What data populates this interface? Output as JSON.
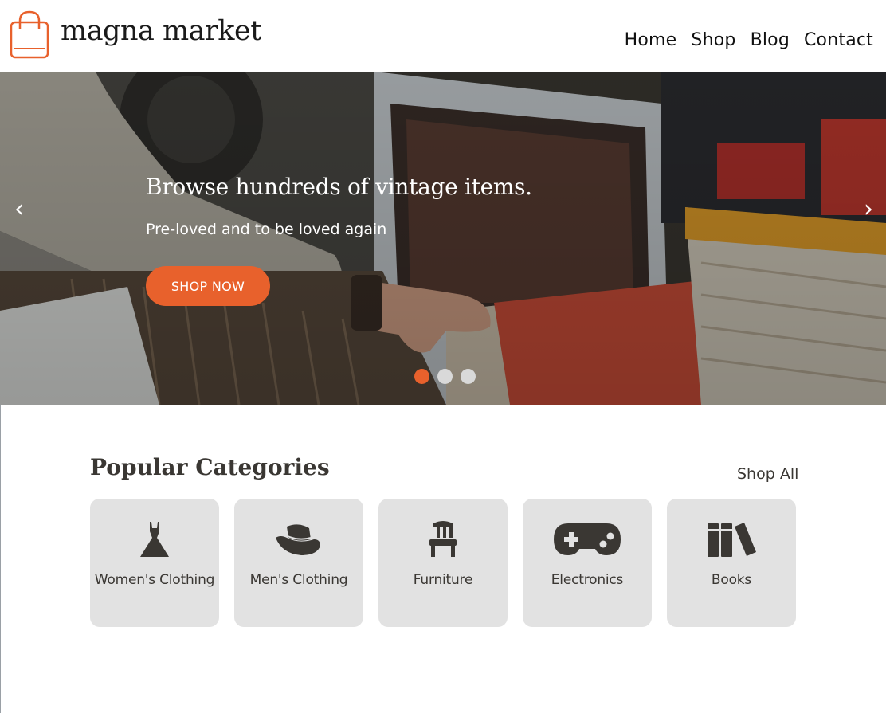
{
  "brand": {
    "name": "magna market",
    "accent": "#e8612c"
  },
  "nav": {
    "items": [
      {
        "label": "Home",
        "name": "nav-home"
      },
      {
        "label": "Shop",
        "name": "nav-shop"
      },
      {
        "label": "Blog",
        "name": "nav-blog"
      },
      {
        "label": "Contact",
        "name": "nav-contact"
      }
    ]
  },
  "hero": {
    "title": "Browse hundreds of vintage items.",
    "subtitle": "Pre-loved and to be loved again",
    "cta": "SHOP NOW",
    "prev_glyph": "‹",
    "next_glyph": "›",
    "slides_count": 3,
    "active_slide": 1
  },
  "categories": {
    "title": "Popular Categories",
    "shop_all": "Shop All",
    "items": [
      {
        "label": "Women's Clothing",
        "icon": "dress-icon"
      },
      {
        "label": "Men's Clothing",
        "icon": "hat-icon"
      },
      {
        "label": "Furniture",
        "icon": "chair-icon"
      },
      {
        "label": "Electronics",
        "icon": "gamepad-icon"
      },
      {
        "label": "Books",
        "icon": "books-icon"
      }
    ]
  }
}
